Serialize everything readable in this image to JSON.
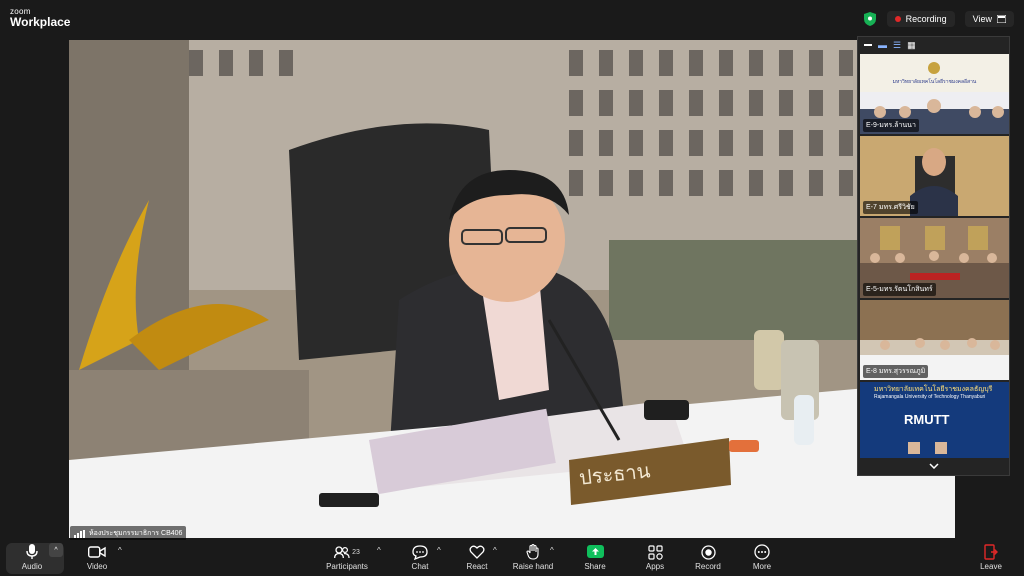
{
  "app": {
    "brand_line1": "zoom",
    "brand_line2": "Workplace"
  },
  "header": {
    "recording_label": "Recording",
    "view_label": "View"
  },
  "main_video": {
    "room_name": "ห้องประชุมกรรมาธิการ CB406",
    "nameplate": "ประธาน"
  },
  "gallery": {
    "tiles": [
      {
        "name": "E-9-มทร.ล้านนา",
        "banner": "มหาวิทยาลัยเทคโนโลยีราชมงคลอีสาน"
      },
      {
        "name": "E-7 มทร.ศรีวิชัย"
      },
      {
        "name": "E-5-มทร.รัตนโกสินทร์"
      },
      {
        "name": "E-8 มทร.สุวรรณภูมิ",
        "banner": "มหาวิทยาลัยเทคโนโลยีราชมงคลธัญบุรี",
        "banner_sub": "Rajamangala University of Technology Thanyaburi",
        "logo_text": "RMUTT"
      }
    ],
    "more_icon": "chevron-down-icon"
  },
  "toolbar": {
    "audio": "Audio",
    "video": "Video",
    "participants": "Participants",
    "participants_count": "23",
    "chat": "Chat",
    "react": "React",
    "raise_hand": "Raise hand",
    "share": "Share",
    "apps": "Apps",
    "record": "Record",
    "more": "More",
    "leave": "Leave"
  },
  "colors": {
    "share_green": "#0fbf5c",
    "leave_red": "#e02828",
    "recording_dot": "#e02828",
    "shield_green": "#17b155"
  }
}
